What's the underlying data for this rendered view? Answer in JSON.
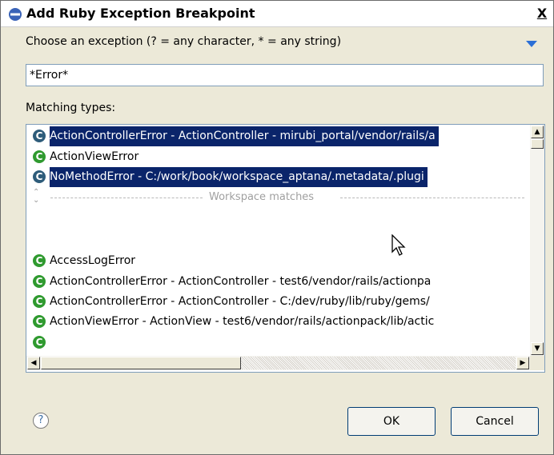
{
  "window": {
    "title": "Add Ruby Exception Breakpoint",
    "close_label": "X"
  },
  "prompt": {
    "text": "Choose an exception (? = any character, * = any string)"
  },
  "filter": {
    "value": "*Error*"
  },
  "matching_label": "Matching types:",
  "list": {
    "rows_top": [
      {
        "icon": "class-icon",
        "text": "ActionControllerError - ActionController - mirubi_portal/vendor/rails/a",
        "selected": true
      },
      {
        "icon": "class-icon",
        "text": "ActionViewError",
        "selected": false
      },
      {
        "icon": "class-icon",
        "text": "NoMethodError - C:/work/book/workspace_aptana/.metadata/.plugi",
        "selected": true
      }
    ],
    "separator": "Workspace matches",
    "rows_bottom": [
      {
        "icon": "class-icon",
        "text": "AccessLogError",
        "selected": false
      },
      {
        "icon": "class-icon",
        "text": "ActionControllerError - ActionController - test6/vendor/rails/actionpa",
        "selected": false
      },
      {
        "icon": "class-icon",
        "text": "ActionControllerError - ActionController - C:/dev/ruby/lib/ruby/gems/",
        "selected": false
      },
      {
        "icon": "class-icon",
        "text": "ActionViewError - ActionView - test6/vendor/rails/actionpack/lib/actic",
        "selected": false
      }
    ]
  },
  "buttons": {
    "ok": "OK",
    "cancel": "Cancel",
    "help": "?"
  },
  "colors": {
    "selection": "#0a246a",
    "icon_green": "#2f9a2f",
    "menu_arrow": "#2b6fd6"
  }
}
